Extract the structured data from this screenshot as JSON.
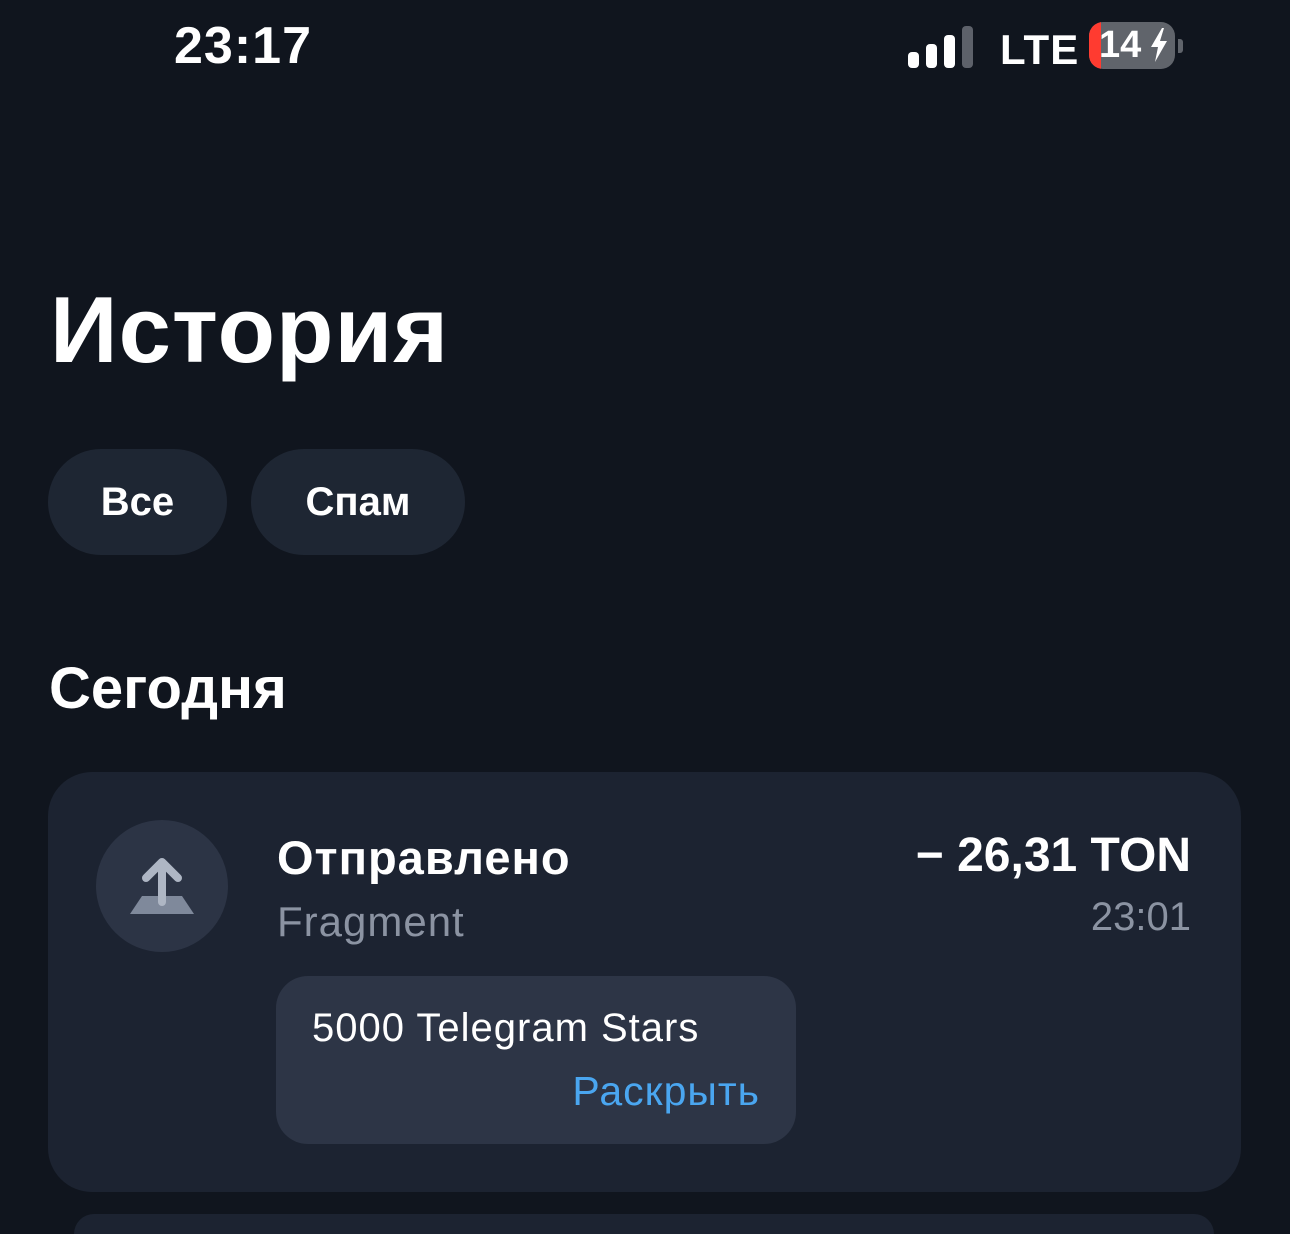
{
  "status_bar": {
    "time": "23:17",
    "network": "LTE",
    "battery_level": "14",
    "battery_fraction": 0.14,
    "signal_bars_active": 3,
    "signal_bars_total": 4
  },
  "page": {
    "title": "История"
  },
  "filters": [
    {
      "label": "Все"
    },
    {
      "label": "Спам"
    }
  ],
  "sections": [
    {
      "heading": "Сегодня",
      "transactions": [
        {
          "type_label": "Отправлено",
          "counterparty": "Fragment",
          "amount": "− 26,31 TON",
          "time": "23:01",
          "comment": "5000 Telegram Stars",
          "expand_label": "Раскрыть",
          "icon": "arrow-up-send-icon"
        }
      ]
    }
  ],
  "colors": {
    "background": "#10151e",
    "card": "#1c2331",
    "chip": "#1e2633",
    "accent_link": "#4aa6f0",
    "secondary_text": "#8b93a2",
    "battery_low": "#ff3b30"
  }
}
